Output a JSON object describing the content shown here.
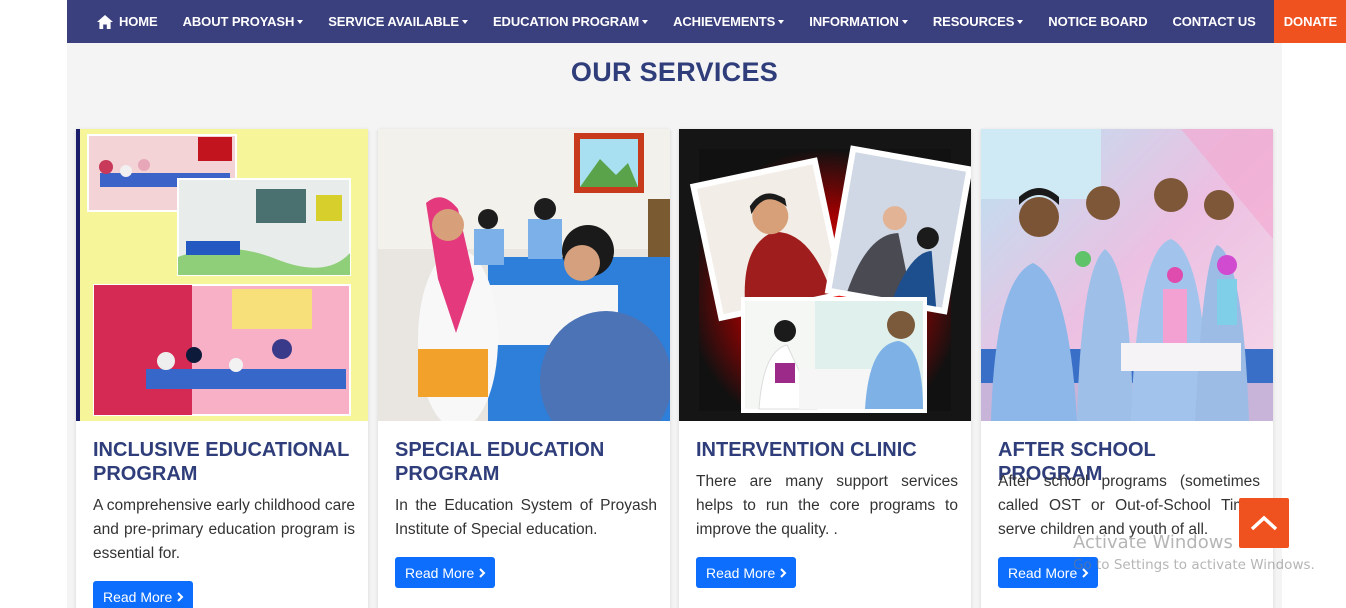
{
  "nav": {
    "items": [
      {
        "label": "HOME",
        "has_caret": false
      },
      {
        "label": "ABOUT PROYASH",
        "has_caret": true
      },
      {
        "label": "SERVICE AVAILABLE",
        "has_caret": true
      },
      {
        "label": "EDUCATION PROGRAM",
        "has_caret": true
      },
      {
        "label": "ACHIEVEMENTS",
        "has_caret": true
      },
      {
        "label": "INFORMATION",
        "has_caret": true
      },
      {
        "label": "RESOURCES",
        "has_caret": true
      },
      {
        "label": "NOTICE BOARD",
        "has_caret": false
      },
      {
        "label": "CONTACT US",
        "has_caret": false
      }
    ],
    "donate": "DONATE",
    "home_icon": "home-icon"
  },
  "section": {
    "title": "OUR SERVICES"
  },
  "cards": [
    {
      "title": "INCLUSIVE EDUCATIONAL PROGRAM",
      "description": "A comprehensive early childhood care and pre-primary education program is essential for.",
      "button": "Read More"
    },
    {
      "title": "SPECIAL EDUCATION PROGRAM",
      "description": "In the Education System of Proyash Institute of Special education.",
      "button": "Read More"
    },
    {
      "title": "INTERVENTION CLINIC",
      "description": "There are many support services helps to run the core programs to improve the quality. .",
      "button": "Read More"
    },
    {
      "title": "AFTER SCHOOL PROGRAM",
      "description": "After school programs (sometimes called OST or Out-of-School Time) serve children and youth of all.",
      "button": "Read More"
    }
  ],
  "scroll_top_icon": "chevron-up-icon",
  "watermark": {
    "line1": "Activate Windows",
    "line2": "Go to Settings to activate Windows."
  },
  "colors": {
    "nav_bg": "#3a3f7e",
    "accent": "#f0521f",
    "heading": "#2f3e7a",
    "button": "#0d6efd"
  }
}
